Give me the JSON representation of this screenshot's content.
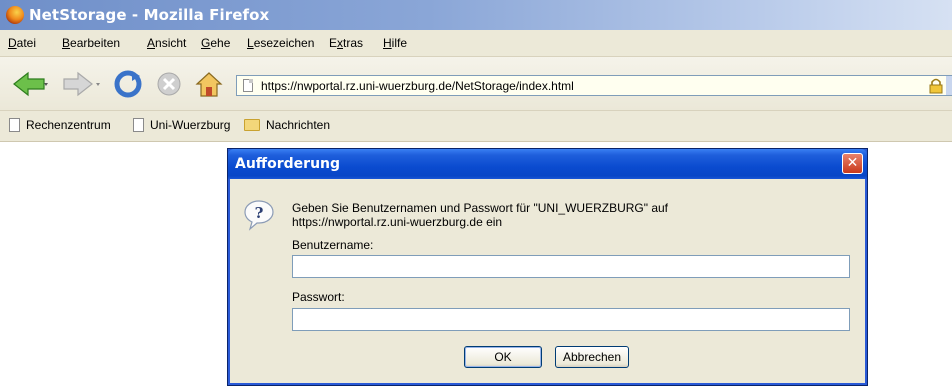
{
  "window": {
    "title": "NetStorage - Mozilla Firefox"
  },
  "menu": [
    {
      "label": "Datei"
    },
    {
      "label": "Bearbeiten"
    },
    {
      "label": "Ansicht"
    },
    {
      "label": "Gehe"
    },
    {
      "label": "Lesezeichen"
    },
    {
      "label": "Extras"
    },
    {
      "label": "Hilfe"
    }
  ],
  "navigation": {
    "url": "https://nwportal.rz.uni-wuerzburg.de/NetStorage/index.html"
  },
  "bookmarks": [
    {
      "label": "Rechenzentrum",
      "icon": "page-icon"
    },
    {
      "label": "Uni-Wuerzburg",
      "icon": "page-icon"
    },
    {
      "label": "Nachrichten",
      "icon": "folder-icon"
    }
  ],
  "dialog": {
    "title": "Aufforderung",
    "message_line1": "Geben Sie Benutzernamen und Passwort für \"UNI_WUERZBURG\" auf",
    "message_line2": "https://nwportal.rz.uni-wuerzburg.de ein",
    "username_label": "Benutzername:",
    "username_value": "",
    "password_label": "Passwort:",
    "password_value": "",
    "ok_label": "OK",
    "cancel_label": "Abbrechen",
    "close_glyph": "✕"
  },
  "colors": {
    "titlebar_start": "#6f8fc9",
    "dialog_titlebar": "#0a4bd0",
    "close_button": "#c9391b",
    "window_face": "#ece9d8"
  }
}
